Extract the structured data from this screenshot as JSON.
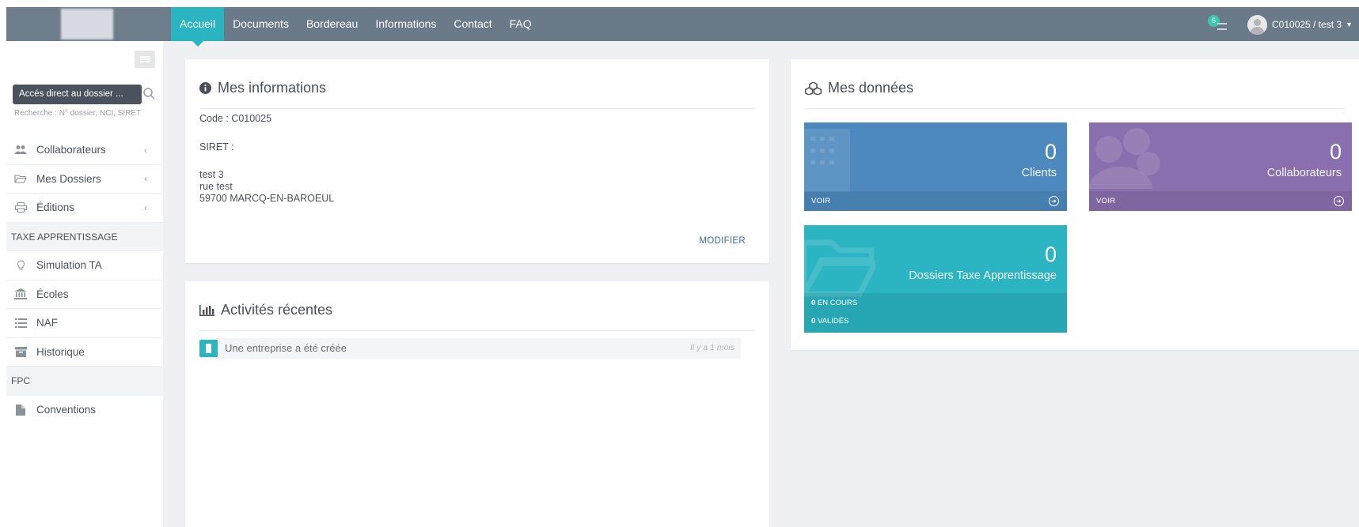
{
  "nav": {
    "items": [
      {
        "label": "Accueil",
        "active": true
      },
      {
        "label": "Documents"
      },
      {
        "label": "Bordereau"
      },
      {
        "label": "Informations"
      },
      {
        "label": "Contact"
      },
      {
        "label": "FAQ"
      }
    ],
    "notification_count": "6",
    "user_label": "C010025 / test 3"
  },
  "sidebar": {
    "search_placeholder": "Accés direct au dossier ...",
    "search_hint": "Recherche : N° dossier, NCI, SIRET",
    "menu": [
      {
        "label": "Collaborateurs",
        "icon": "users-icon"
      },
      {
        "label": "Mes Dossiers",
        "icon": "folder-open-icon"
      },
      {
        "label": "Éditions",
        "icon": "print-icon"
      }
    ],
    "section_ta": "TAXE APPRENTISSAGE",
    "ta_items": [
      {
        "label": "Simulation TA",
        "icon": "lightbulb-icon"
      },
      {
        "label": "Écoles",
        "icon": "bank-icon"
      },
      {
        "label": "NAF",
        "icon": "list-icon"
      },
      {
        "label": "Historique",
        "icon": "archive-icon"
      }
    ],
    "section_fpc": "FPC",
    "fpc_items": [
      {
        "label": "Conventions",
        "icon": "file-icon"
      }
    ]
  },
  "info": {
    "title": "Mes informations",
    "code": "Code : C010025",
    "siret": "SIRET :",
    "address": [
      "test 3",
      "rue test",
      "59700 MARCQ-EN-BAROEUL"
    ],
    "modify_label": "MODIFIER"
  },
  "activities": {
    "title": "Activités récentes",
    "items": [
      {
        "text": "Une entreprise a été créée",
        "time": "Il y a 1 mois"
      }
    ]
  },
  "data": {
    "title": "Mes données",
    "tiles": {
      "clients": {
        "value": "0",
        "label": "Clients",
        "link": "VOIR",
        "color": "#4d89bf"
      },
      "collaborateurs": {
        "value": "0",
        "label": "Collaborateurs",
        "link": "VOIR",
        "color": "#8a6fae"
      },
      "dossiers": {
        "value": "0",
        "label": "Dossiers Taxe Apprentissage",
        "color": "#2bb4c1",
        "en_cours_count": "0",
        "en_cours_label": "EN COURS",
        "valides_count": "0",
        "valides_label": "VALIDÉS"
      }
    }
  },
  "colors": {
    "topbar": "#6b7a89",
    "accent": "#2bb4c1"
  }
}
